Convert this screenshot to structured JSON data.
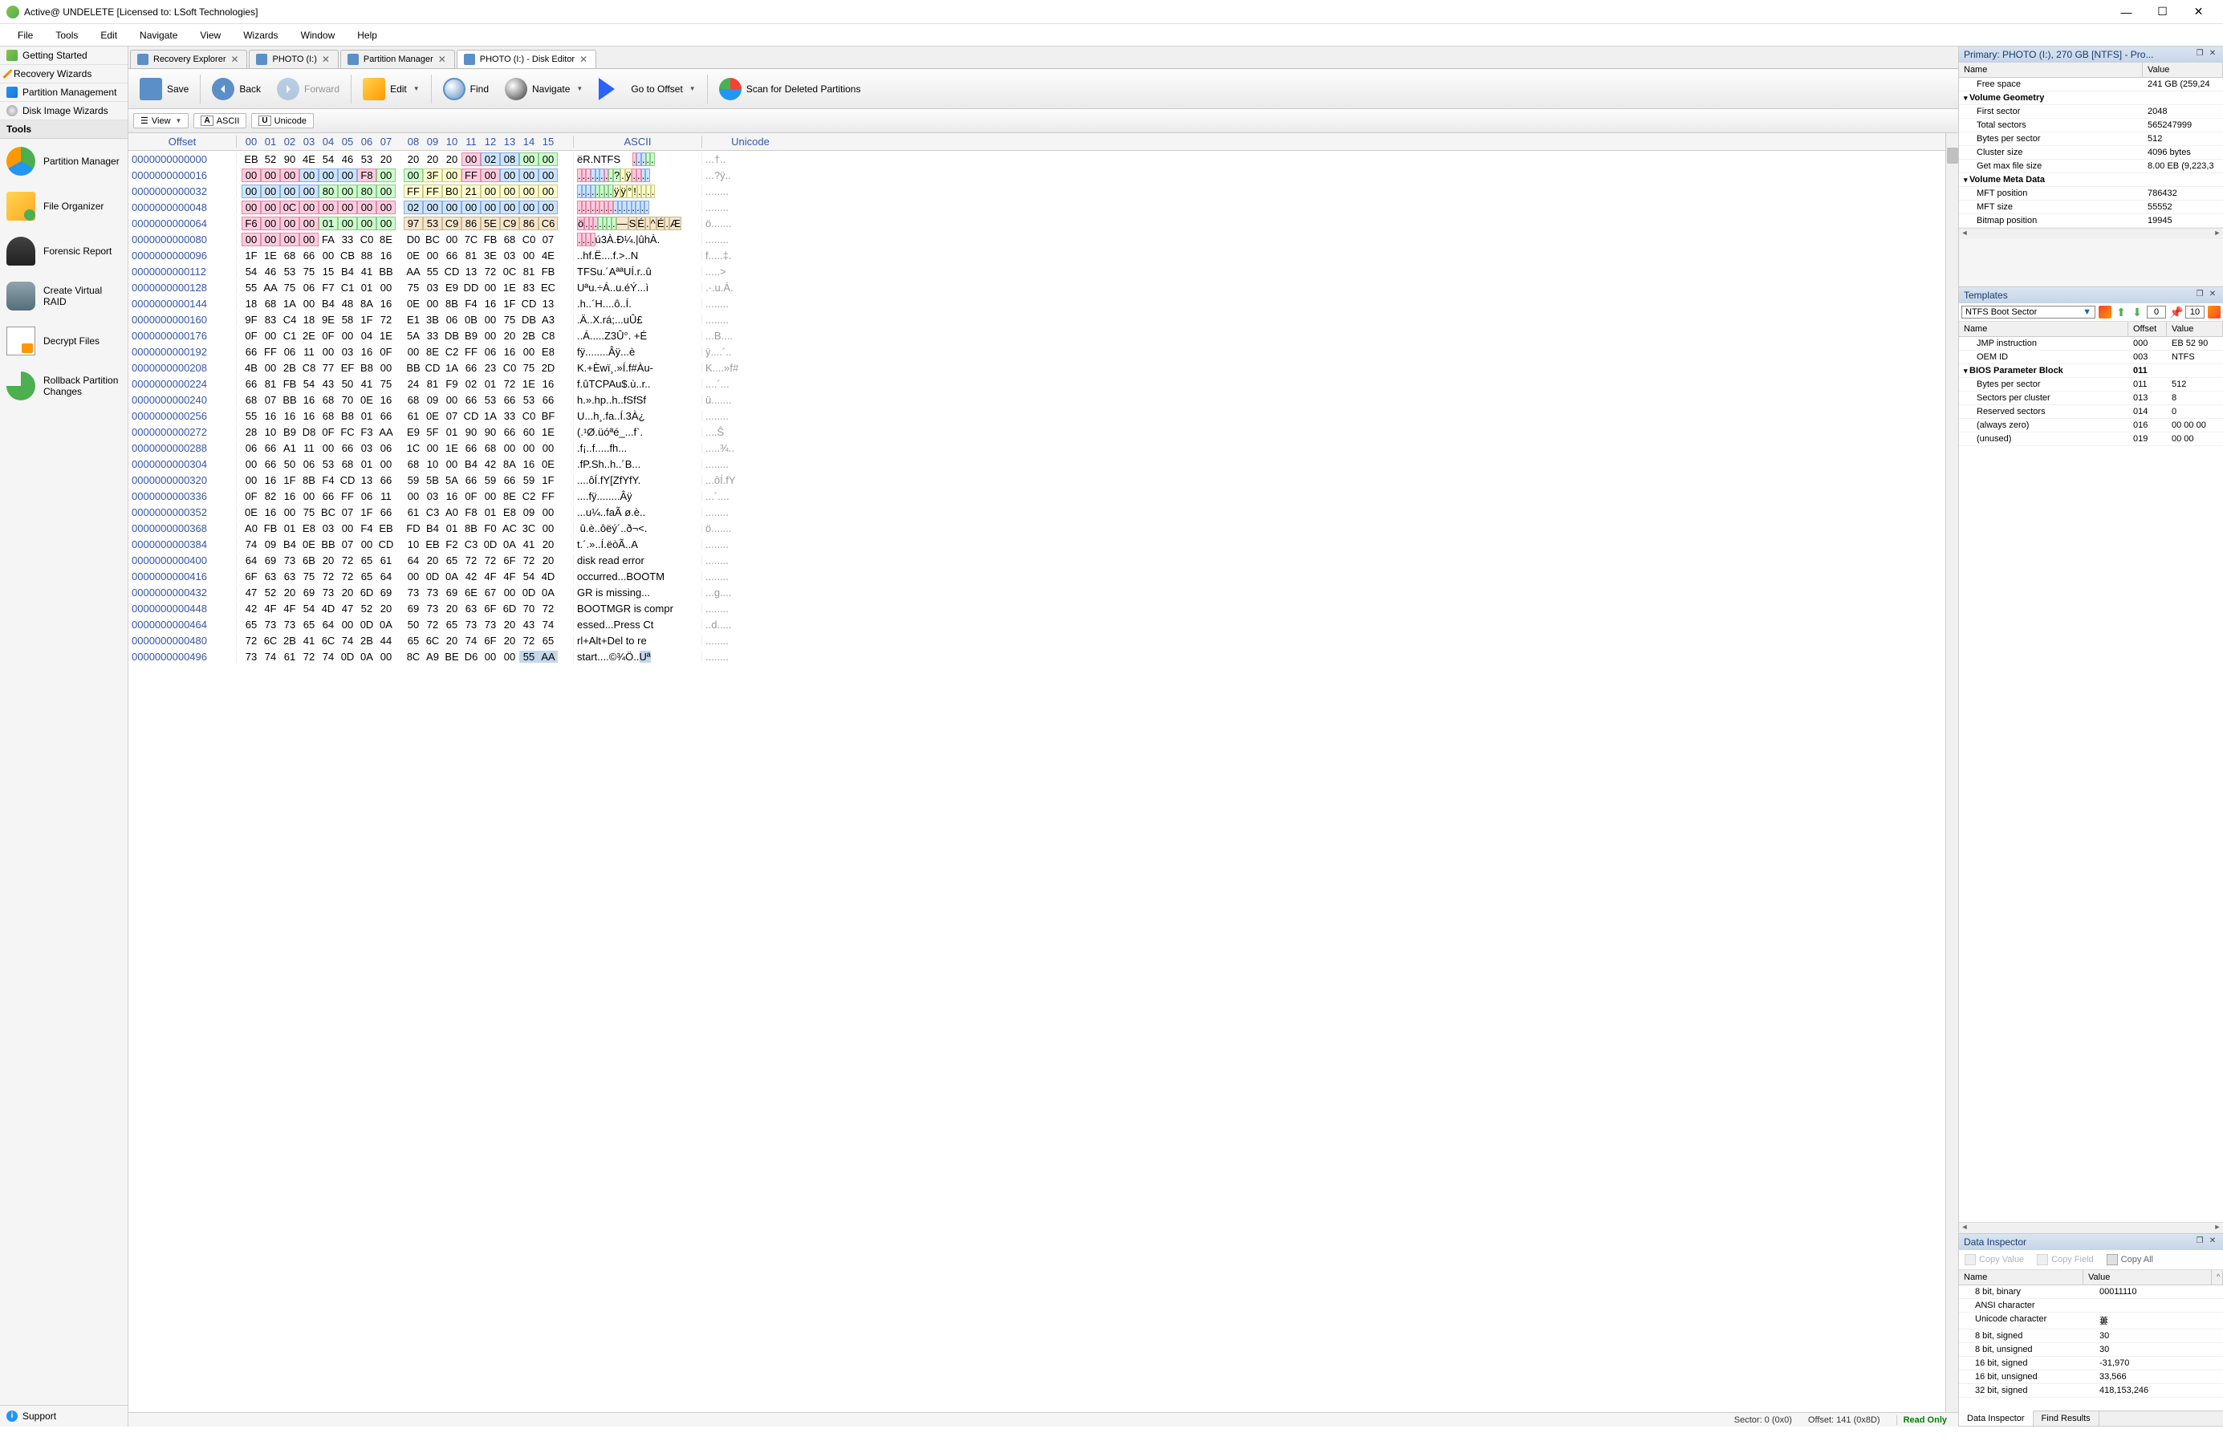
{
  "title": "Active@ UNDELETE [Licensed to: LSoft Technologies]",
  "menus": [
    "File",
    "Tools",
    "Edit",
    "Navigate",
    "View",
    "Wizards",
    "Window",
    "Help"
  ],
  "sidebar_links": [
    {
      "label": "Getting Started",
      "icon": "sb-green"
    },
    {
      "label": "Recovery Wizards",
      "icon": "sb-wand"
    },
    {
      "label": "Partition Management",
      "icon": "sb-part"
    },
    {
      "label": "Disk Image Wizards",
      "icon": "sb-cd"
    }
  ],
  "sidebar_tools_header": "Tools",
  "tools": [
    {
      "label": "Partition Manager",
      "icon": "icon-pie"
    },
    {
      "label": "File Organizer",
      "icon": "icon-folder"
    },
    {
      "label": "Forensic Report",
      "icon": "icon-suit"
    },
    {
      "label": "Create Virtual RAID",
      "icon": "icon-db"
    },
    {
      "label": "Decrypt Files",
      "icon": "icon-doc"
    },
    {
      "label": "Rollback Partition Changes",
      "icon": "icon-rb"
    }
  ],
  "support": "Support",
  "tabs": [
    {
      "label": "Recovery Explorer",
      "active": false
    },
    {
      "label": "PHOTO (I:)",
      "active": false
    },
    {
      "label": "Partition Manager",
      "active": false
    },
    {
      "label": "PHOTO (I:) - Disk Editor",
      "active": true
    }
  ],
  "toolbar": {
    "save": "Save",
    "back": "Back",
    "forward": "Forward",
    "edit": "Edit",
    "find": "Find",
    "navigate": "Navigate",
    "goto": "Go to Offset",
    "scan": "Scan for Deleted Partitions"
  },
  "view_toolbar": {
    "view": "View",
    "ascii": "ASCII",
    "unicode": "Unicode",
    "ascii_badge": "A",
    "unicode_badge": "U"
  },
  "hex_header": {
    "offset": "Offset",
    "ascii": "ASCII",
    "unicode": "Unicode",
    "cols": [
      "00",
      "01",
      "02",
      "03",
      "04",
      "05",
      "06",
      "07",
      "08",
      "09",
      "10",
      "11",
      "12",
      "13",
      "14",
      "15"
    ]
  },
  "hex_rows": [
    {
      "off": "0000000000000",
      "h": [
        "EB",
        "52",
        "90",
        "4E",
        "54",
        "46",
        "53",
        "20",
        "20",
        "20",
        "20",
        "00",
        "02",
        "08",
        "00",
        "00"
      ],
      "a": "ëR.NTFS    .....",
      "u": "...†..",
      "hl": [
        [
          11,
          1,
          "pink"
        ],
        [
          12,
          2,
          "blue"
        ],
        [
          14,
          2,
          "green"
        ]
      ]
    },
    {
      "off": "0000000000016",
      "h": [
        "00",
        "00",
        "00",
        "00",
        "00",
        "00",
        "F8",
        "00",
        "00",
        "3F",
        "00",
        "FF",
        "00",
        "00",
        "00",
        "00"
      ],
      "a": "........?.ÿ....",
      "u": "...?ÿ..",
      "hl": [
        [
          0,
          2,
          "pink"
        ],
        [
          2,
          1,
          "pink"
        ],
        [
          3,
          2,
          "blue"
        ],
        [
          5,
          1,
          "blue"
        ],
        [
          6,
          1,
          "pink"
        ],
        [
          7,
          2,
          "green"
        ],
        [
          9,
          2,
          "yellow"
        ],
        [
          11,
          2,
          "pink"
        ],
        [
          13,
          3,
          "blue"
        ]
      ]
    },
    {
      "off": "0000000000032",
      "h": [
        "00",
        "00",
        "00",
        "00",
        "80",
        "00",
        "80",
        "00",
        "FF",
        "FF",
        "B0",
        "21",
        "00",
        "00",
        "00",
        "00"
      ],
      "a": "........ÿÿ°!....",
      "u": "........",
      "hl": [
        [
          0,
          4,
          "blue"
        ],
        [
          4,
          4,
          "green"
        ],
        [
          8,
          8,
          "yellow"
        ]
      ]
    },
    {
      "off": "0000000000048",
      "h": [
        "00",
        "00",
        "0C",
        "00",
        "00",
        "00",
        "00",
        "00",
        "02",
        "00",
        "00",
        "00",
        "00",
        "00",
        "00",
        "00"
      ],
      "a": "................",
      "u": "........",
      "hl": [
        [
          0,
          8,
          "pink"
        ],
        [
          8,
          8,
          "blue"
        ]
      ]
    },
    {
      "off": "0000000000064",
      "h": [
        "F6",
        "00",
        "00",
        "00",
        "01",
        "00",
        "00",
        "00",
        "97",
        "53",
        "C9",
        "86",
        "5E",
        "C9",
        "86",
        "C6"
      ],
      "a": "ö.......—SÉ.^É.Æ",
      "u": "ö.......",
      "hl": [
        [
          0,
          4,
          "pink"
        ],
        [
          4,
          4,
          "green"
        ],
        [
          8,
          8,
          "tan"
        ]
      ]
    },
    {
      "off": "0000000000080",
      "h": [
        "00",
        "00",
        "00",
        "00",
        "FA",
        "33",
        "C0",
        "8E",
        "D0",
        "BC",
        "00",
        "7C",
        "FB",
        "68",
        "C0",
        "07"
      ],
      "a": "....ú3À.Ð¼.|ûhÀ.",
      "u": "........",
      "hl": [
        [
          0,
          4,
          "pink"
        ]
      ]
    },
    {
      "off": "0000000000096",
      "h": [
        "1F",
        "1E",
        "68",
        "66",
        "00",
        "CB",
        "88",
        "16",
        "0E",
        "00",
        "66",
        "81",
        "3E",
        "03",
        "00",
        "4E"
      ],
      "a": "..hf.Ë....f.>..N",
      "u": "f.....‡."
    },
    {
      "off": "0000000000112",
      "h": [
        "54",
        "46",
        "53",
        "75",
        "15",
        "B4",
        "41",
        "BB",
        "AA",
        "55",
        "CD",
        "13",
        "72",
        "0C",
        "81",
        "FB"
      ],
      "a": "TFSu.´AªªUÍ.r..û",
      "u": ".....>"
    },
    {
      "off": "0000000000128",
      "h": [
        "55",
        "AA",
        "75",
        "06",
        "F7",
        "C1",
        "01",
        "00",
        "75",
        "03",
        "E9",
        "DD",
        "00",
        "1E",
        "83",
        "EC"
      ],
      "a": "Uªu.÷Á..u.éÝ...ì",
      "u": ".·.u.Á."
    },
    {
      "off": "0000000000144",
      "h": [
        "18",
        "68",
        "1A",
        "00",
        "B4",
        "48",
        "8A",
        "16",
        "0E",
        "00",
        "8B",
        "F4",
        "16",
        "1F",
        "CD",
        "13"
      ],
      "a": ".h..´H....ô..Í.",
      "u": "........"
    },
    {
      "off": "0000000000160",
      "h": [
        "9F",
        "83",
        "C4",
        "18",
        "9E",
        "58",
        "1F",
        "72",
        "E1",
        "3B",
        "06",
        "0B",
        "00",
        "75",
        "DB",
        "A3"
      ],
      "a": ".Ä..X.rá;...uÛ£",
      "u": "........"
    },
    {
      "off": "0000000000176",
      "h": [
        "0F",
        "00",
        "C1",
        "2E",
        "0F",
        "00",
        "04",
        "1E",
        "5A",
        "33",
        "DB",
        "B9",
        "00",
        "20",
        "2B",
        "C8"
      ],
      "a": "..Á.....Z3Û°. +É",
      "u": "...B...."
    },
    {
      "off": "0000000000192",
      "h": [
        "66",
        "FF",
        "06",
        "11",
        "00",
        "03",
        "16",
        "0F",
        "00",
        "8E",
        "C2",
        "FF",
        "06",
        "16",
        "00",
        "E8"
      ],
      "a": "fÿ........Âÿ...è",
      "u": "ÿ....´.."
    },
    {
      "off": "0000000000208",
      "h": [
        "4B",
        "00",
        "2B",
        "C8",
        "77",
        "EF",
        "B8",
        "00",
        "BB",
        "CD",
        "1A",
        "66",
        "23",
        "C0",
        "75",
        "2D"
      ],
      "a": "K.+Èwï¸.»Í.f#Àu-",
      "u": "K....»f#"
    },
    {
      "off": "0000000000224",
      "h": [
        "66",
        "81",
        "FB",
        "54",
        "43",
        "50",
        "41",
        "75",
        "24",
        "81",
        "F9",
        "02",
        "01",
        "72",
        "1E",
        "16"
      ],
      "a": "f.ûTCPAu$.ù..r..",
      "u": "....´..."
    },
    {
      "off": "0000000000240",
      "h": [
        "68",
        "07",
        "BB",
        "16",
        "68",
        "70",
        "0E",
        "16",
        "68",
        "09",
        "00",
        "66",
        "53",
        "66",
        "53",
        "66"
      ],
      "a": "h.».hp..h..fSfSf",
      "u": "ü......."
    },
    {
      "off": "0000000000256",
      "h": [
        "55",
        "16",
        "16",
        "16",
        "68",
        "B8",
        "01",
        "66",
        "61",
        "0E",
        "07",
        "CD",
        "1A",
        "33",
        "C0",
        "BF"
      ],
      "a": "U...h¸.fa..Í.3À¿",
      "u": "........"
    },
    {
      "off": "0000000000272",
      "h": [
        "28",
        "10",
        "B9",
        "D8",
        "0F",
        "FC",
        "F3",
        "AA",
        "E9",
        "5F",
        "01",
        "90",
        "90",
        "66",
        "60",
        "1E"
      ],
      "a": "(.¹Ø.üóªé_...f`.",
      "u": "....Ŝ"
    },
    {
      "off": "0000000000288",
      "h": [
        "06",
        "66",
        "A1",
        "11",
        "00",
        "66",
        "03",
        "06",
        "1C",
        "00",
        "1E",
        "66",
        "68",
        "00",
        "00",
        "00"
      ],
      "a": ".f¡..f.....fh...",
      "u": ".....¾.."
    },
    {
      "off": "0000000000304",
      "h": [
        "00",
        "66",
        "50",
        "06",
        "53",
        "68",
        "01",
        "00",
        "68",
        "10",
        "00",
        "B4",
        "42",
        "8A",
        "16",
        "0E"
      ],
      "a": ".fP.Sh..h..´B...",
      "u": "........"
    },
    {
      "off": "0000000000320",
      "h": [
        "00",
        "16",
        "1F",
        "8B",
        "F4",
        "CD",
        "13",
        "66",
        "59",
        "5B",
        "5A",
        "66",
        "59",
        "66",
        "59",
        "1F"
      ],
      "a": "....ôÍ.fY[ZfYfY.",
      "u": "...ôÍ.fY"
    },
    {
      "off": "0000000000336",
      "h": [
        "0F",
        "82",
        "16",
        "00",
        "66",
        "FF",
        "06",
        "11",
        "00",
        "03",
        "16",
        "0F",
        "00",
        "8E",
        "C2",
        "FF"
      ],
      "a": "....fÿ........Âÿ",
      "u": "...´...."
    },
    {
      "off": "0000000000352",
      "h": [
        "0E",
        "16",
        "00",
        "75",
        "BC",
        "07",
        "1F",
        "66",
        "61",
        "C3",
        "A0",
        "F8",
        "01",
        "E8",
        "09",
        "00"
      ],
      "a": "...u¼..faÃ ø.è..",
      "u": "........"
    },
    {
      "off": "0000000000368",
      "h": [
        "A0",
        "FB",
        "01",
        "E8",
        "03",
        "00",
        "F4",
        "EB",
        "FD",
        "B4",
        "01",
        "8B",
        "F0",
        "AC",
        "3C",
        "00"
      ],
      "a": " û.è..ôëý´..ð¬<.",
      "u": "ö......."
    },
    {
      "off": "0000000000384",
      "h": [
        "74",
        "09",
        "B4",
        "0E",
        "BB",
        "07",
        "00",
        "CD",
        "10",
        "EB",
        "F2",
        "C3",
        "0D",
        "0A",
        "41",
        "20"
      ],
      "a": "t.´.»..Í.ëòÃ..A ",
      "u": "........"
    },
    {
      "off": "0000000000400",
      "h": [
        "64",
        "69",
        "73",
        "6B",
        "20",
        "72",
        "65",
        "61",
        "64",
        "20",
        "65",
        "72",
        "72",
        "6F",
        "72",
        "20"
      ],
      "a": "disk read error ",
      "u": "........"
    },
    {
      "off": "0000000000416",
      "h": [
        "6F",
        "63",
        "63",
        "75",
        "72",
        "72",
        "65",
        "64",
        "00",
        "0D",
        "0A",
        "42",
        "4F",
        "4F",
        "54",
        "4D"
      ],
      "a": "occurred...BOOTM",
      "u": "........"
    },
    {
      "off": "0000000000432",
      "h": [
        "47",
        "52",
        "20",
        "69",
        "73",
        "20",
        "6D",
        "69",
        "73",
        "73",
        "69",
        "6E",
        "67",
        "00",
        "0D",
        "0A"
      ],
      "a": "GR is missing...",
      "u": "...g...."
    },
    {
      "off": "0000000000448",
      "h": [
        "42",
        "4F",
        "4F",
        "54",
        "4D",
        "47",
        "52",
        "20",
        "69",
        "73",
        "20",
        "63",
        "6F",
        "6D",
        "70",
        "72"
      ],
      "a": "BOOTMGR is compr",
      "u": "........"
    },
    {
      "off": "0000000000464",
      "h": [
        "65",
        "73",
        "73",
        "65",
        "64",
        "00",
        "0D",
        "0A",
        "50",
        "72",
        "65",
        "73",
        "73",
        "20",
        "43",
        "74"
      ],
      "a": "essed...Press Ct",
      "u": "..d....."
    },
    {
      "off": "0000000000480",
      "h": [
        "72",
        "6C",
        "2B",
        "41",
        "6C",
        "74",
        "2B",
        "44",
        "65",
        "6C",
        "20",
        "74",
        "6F",
        "20",
        "72",
        "65"
      ],
      "a": "rl+Alt+Del to re",
      "u": "........"
    },
    {
      "off": "0000000000496",
      "h": [
        "73",
        "74",
        "61",
        "72",
        "74",
        "0D",
        "0A",
        "00",
        "8C",
        "A9",
        "BE",
        "D6",
        "00",
        "00",
        "55",
        "AA"
      ],
      "a": "start....©¾Ö..Uª",
      "u": "........",
      "hl": [
        [
          14,
          2,
          "sel"
        ]
      ]
    }
  ],
  "statusbar": {
    "sector_label": "Sector:",
    "sector": "0 (0x0)",
    "offset_label": "Offset:",
    "offset": "141 (0x8D)",
    "mode": "Read Only"
  },
  "properties": {
    "title": "Primary: PHOTO (I:), 270 GB [NTFS] - Pro...",
    "hdr_name": "Name",
    "hdr_value": "Value",
    "rows": [
      {
        "name": "Free space",
        "val": "241 GB (259,24",
        "indent": true
      },
      {
        "name": "Volume Geometry",
        "val": "",
        "group": true
      },
      {
        "name": "First sector",
        "val": "2048",
        "indent": true
      },
      {
        "name": "Total sectors",
        "val": "565247999",
        "indent": true
      },
      {
        "name": "Bytes per sector",
        "val": "512",
        "indent": true
      },
      {
        "name": "Cluster size",
        "val": "4096 bytes",
        "indent": true
      },
      {
        "name": "Get max file size",
        "val": "8.00 EB (9,223,3",
        "indent": true
      },
      {
        "name": "Volume Meta Data",
        "val": "",
        "group": true
      },
      {
        "name": "MFT position",
        "val": "786432",
        "indent": true
      },
      {
        "name": "MFT size",
        "val": "55552",
        "indent": true
      },
      {
        "name": "Bitmap position",
        "val": "19945",
        "indent": true
      }
    ]
  },
  "templates": {
    "title": "Templates",
    "selected": "NTFS Boot Sector",
    "num1": "0",
    "num2": "10",
    "hdr_name": "Name",
    "hdr_offset": "Offset",
    "hdr_value": "Value",
    "rows": [
      {
        "name": "JMP instruction",
        "off": "000",
        "val": "EB 52 90",
        "indent": true
      },
      {
        "name": "OEM ID",
        "off": "003",
        "val": "NTFS",
        "indent": true
      },
      {
        "name": "BIOS Parameter Block",
        "off": "011",
        "val": "",
        "group": true
      },
      {
        "name": "Bytes per sector",
        "off": "011",
        "val": "512",
        "indent": true
      },
      {
        "name": "Sectors per cluster",
        "off": "013",
        "val": "8",
        "indent": true
      },
      {
        "name": "Reserved sectors",
        "off": "014",
        "val": "0",
        "indent": true
      },
      {
        "name": "(always zero)",
        "off": "016",
        "val": "00 00 00",
        "indent": true
      },
      {
        "name": "(unused)",
        "off": "019",
        "val": "00 00",
        "indent": true
      }
    ]
  },
  "data_inspector": {
    "title": "Data Inspector",
    "copy_value": "Copy Value",
    "copy_field": "Copy Field",
    "copy_all": "Copy All",
    "hdr_name": "Name",
    "hdr_value": "Value",
    "rows": [
      {
        "name": "8 bit, binary",
        "val": "00011110"
      },
      {
        "name": "ANSI character",
        "val": ""
      },
      {
        "name": "Unicode character",
        "val": "蔞"
      },
      {
        "name": "8 bit, signed",
        "val": "30"
      },
      {
        "name": "8 bit, unsigned",
        "val": "30"
      },
      {
        "name": "16 bit, signed",
        "val": "-31,970"
      },
      {
        "name": "16 bit, unsigned",
        "val": "33,566"
      },
      {
        "name": "32 bit, signed",
        "val": "418,153,246"
      }
    ],
    "tab_di": "Data Inspector",
    "tab_fr": "Find Results"
  }
}
